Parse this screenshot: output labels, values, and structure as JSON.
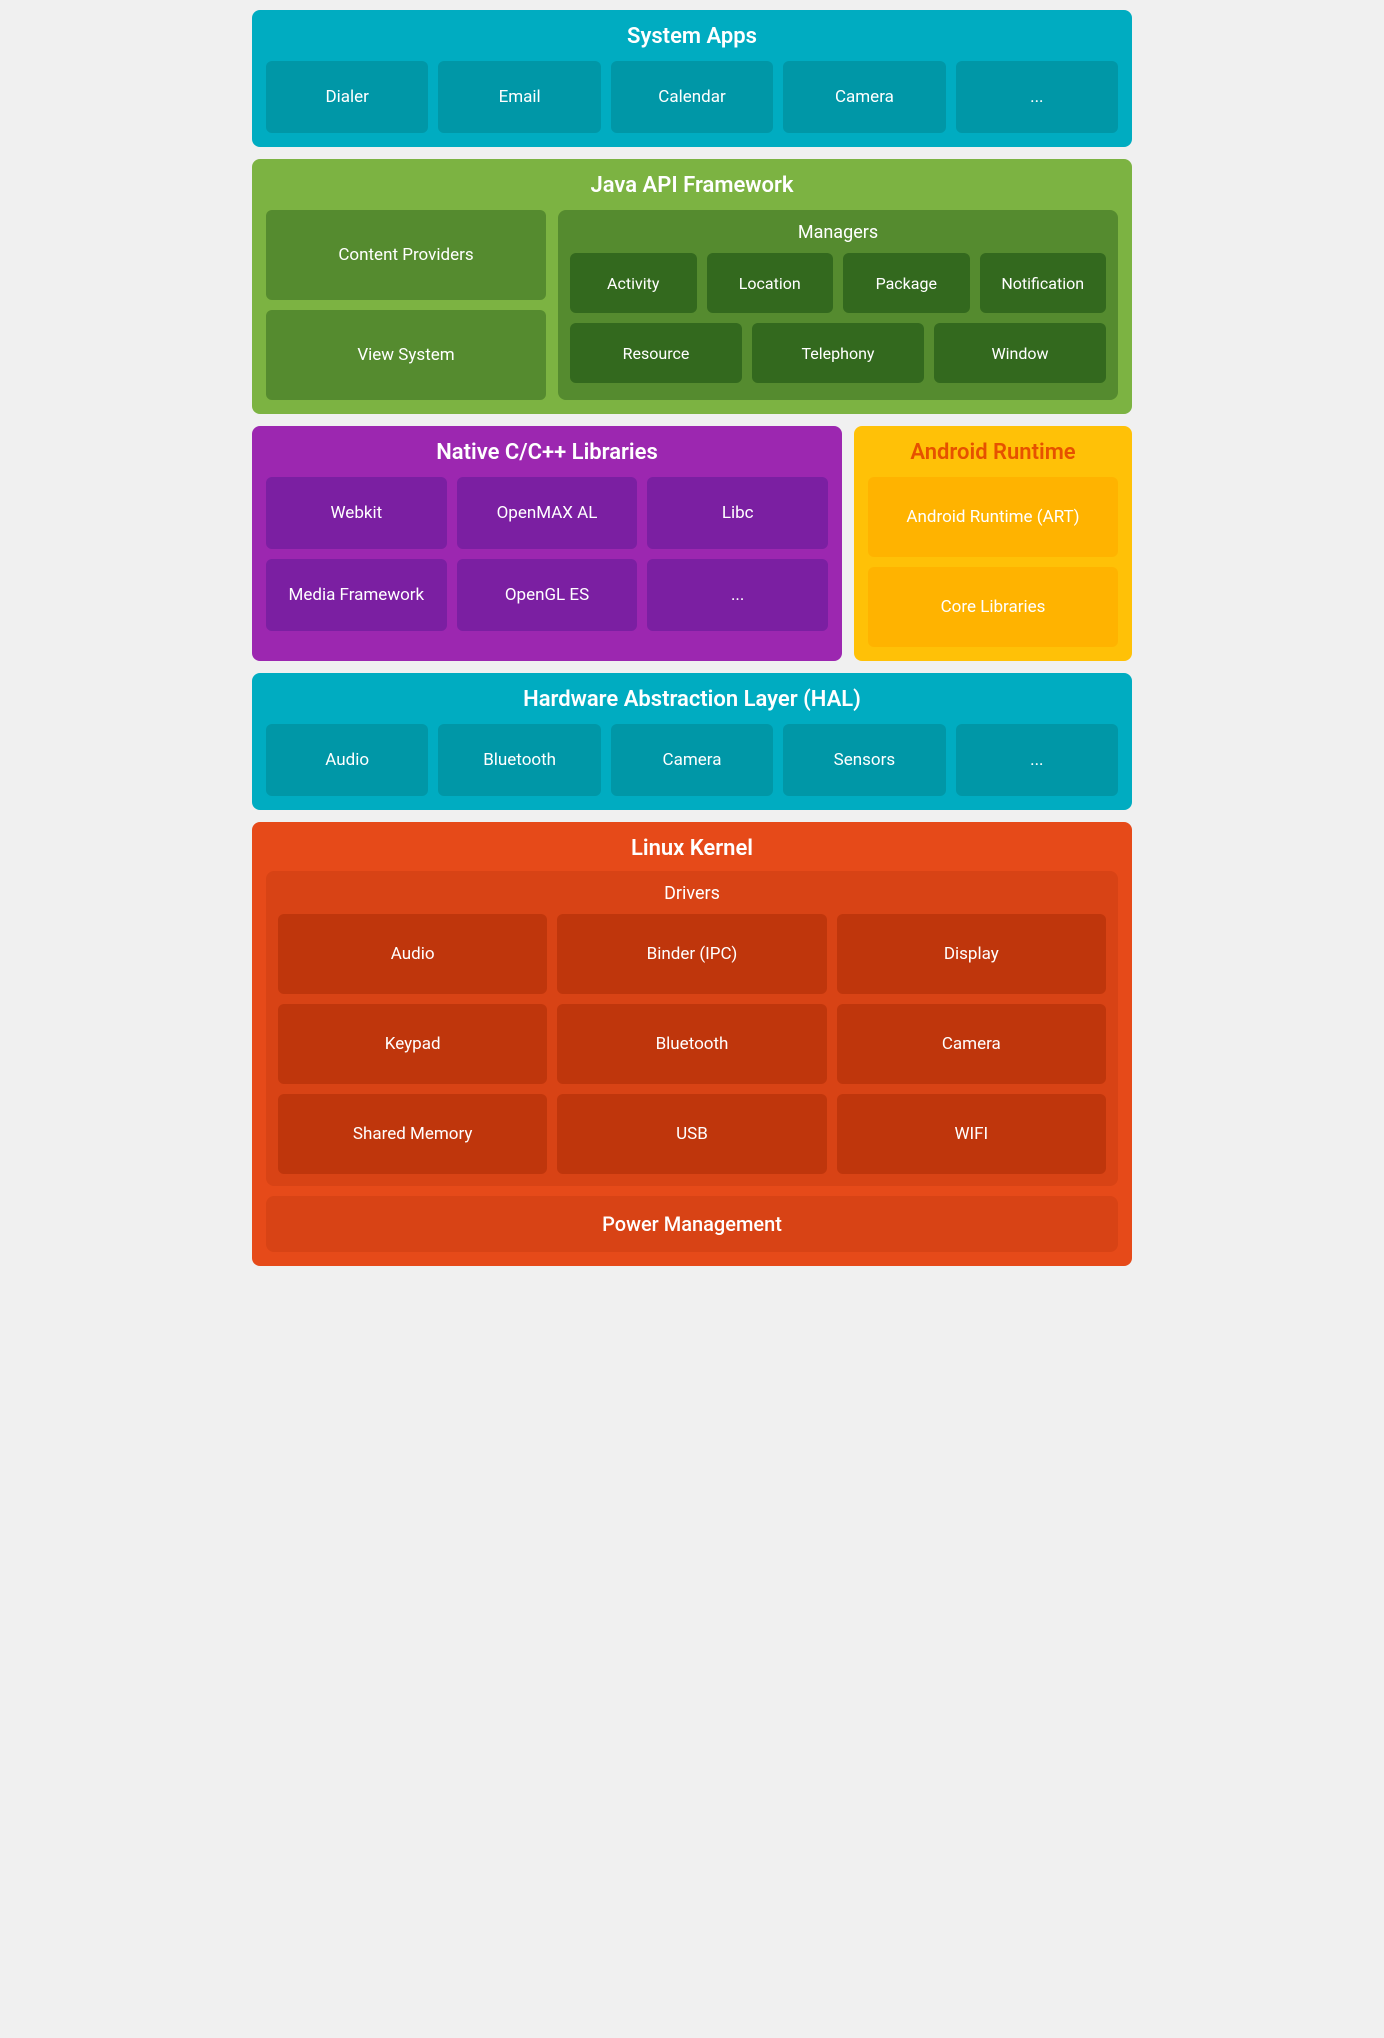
{
  "systemApps": {
    "title": "System Apps",
    "tiles": [
      "Dialer",
      "Email",
      "Calendar",
      "Camera",
      "..."
    ]
  },
  "javaAPI": {
    "title": "Java API Framework",
    "left": [
      "Content Providers",
      "View System"
    ],
    "managers": {
      "title": "Managers",
      "row1": [
        "Activity",
        "Location",
        "Package",
        "Notification"
      ],
      "row2": [
        "Resource",
        "Telephony",
        "Window"
      ]
    }
  },
  "nativeLibs": {
    "title": "Native C/C++ Libraries",
    "row1": [
      "Webkit",
      "OpenMAX AL",
      "Libc"
    ],
    "row2": [
      "Media Framework",
      "OpenGL ES",
      "..."
    ]
  },
  "androidRuntime": {
    "title": "Android Runtime",
    "tiles": [
      "Android Runtime (ART)",
      "Core Libraries"
    ]
  },
  "hal": {
    "title": "Hardware Abstraction Layer (HAL)",
    "tiles": [
      "Audio",
      "Bluetooth",
      "Camera",
      "Sensors",
      "..."
    ]
  },
  "linuxKernel": {
    "title": "Linux Kernel",
    "drivers": {
      "title": "Drivers",
      "row1": [
        "Audio",
        "Binder (IPC)",
        "Display"
      ],
      "row2": [
        "Keypad",
        "Bluetooth",
        "Camera"
      ],
      "row3": [
        "Shared Memory",
        "USB",
        "WIFI"
      ]
    },
    "powerManagement": "Power Management"
  }
}
